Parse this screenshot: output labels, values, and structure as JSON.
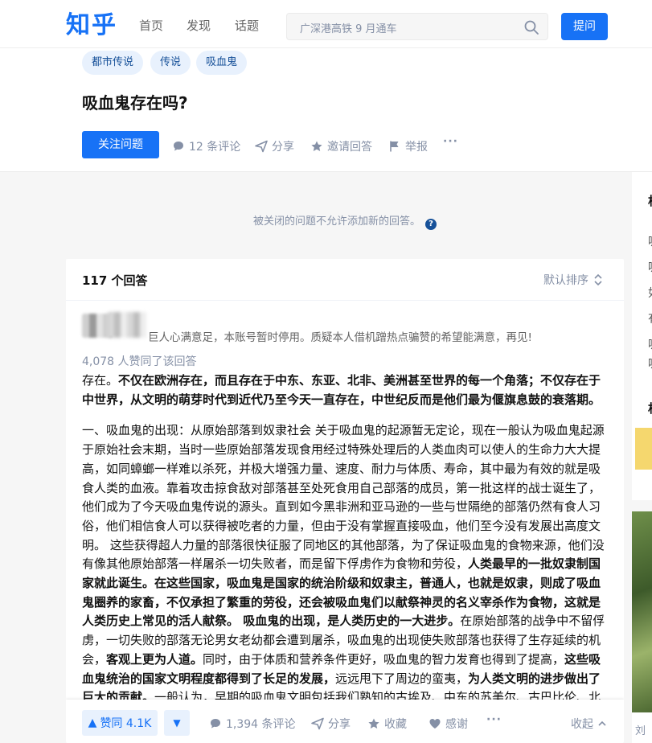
{
  "header": {
    "logo": "知乎",
    "nav": [
      "首页",
      "发现",
      "话题"
    ],
    "search_placeholder": "广深港高铁 9 月通车",
    "ask_label": "提问"
  },
  "question": {
    "tags": [
      "都市传说",
      "传说",
      "吸血鬼"
    ],
    "title": "吸血鬼存在吗?",
    "follow_label": "关注问题",
    "actions": {
      "comments": "12 条评论",
      "share": "分享",
      "invite": "邀请回答",
      "report": "举报",
      "more": "···"
    }
  },
  "closed_note": "被关闭的问题不允许添加新的回答。",
  "answers": {
    "count_label": "117 个回答",
    "sort_label": "默认排序",
    "author_bio": "巨人心满意足，本账号暂时停用。质疑本人借机蹭热点骗赞的希望能满意，再见!",
    "upvote_note": "4,078 人赞同了该回答",
    "para1": "存在。不仅在欧洲存在，而且存在于中东、东亚、北非、美洲甚至世界的每一个角落；不仅存在于中世界，从文明的萌芽时代到近代乃至今天一直存在，中世纪反而是他们最为偃旗息鼓的衰落期。",
    "para1_lead": "存在。",
    "para1_bold": "不仅在欧洲存在，而且存在于中东、东亚、北非、美洲甚至世界的每一个角落；不仅存在于中世界，从文明的萌芽时代到近代乃至今天一直存在，中世纪反而是他们最为偃旗息鼓的衰落期。",
    "p2_a": "一、吸血鬼的出现：从原始部落到奴隶社会 关于吸血鬼的起源暂无定论，现在一般认为吸血鬼起源于原始社会末期，当时一些原始部落发现食用经过特殊处理后的人类血肉可以使人的生命力大大提高，如同蟑螂一样难以杀死，并极大增强力量、速度、耐力与体质、寿命，其中最为有效的就是吸食人类的血液。靠着攻击掠食敌对部落甚至处死食用自己部落的成员，第一批这样的战士诞生了，他们成为了今天吸血鬼传说的源头。直到如今黑非洲和亚马逊的一些与世隔绝的部落仍然有食人习俗，他们相信食人可以获得被吃者的力量，但由于没有掌握直接吸血，他们至今没有发展出高度文明。 这些获得超人力量的部落很快征服了同地区的其他部落，为了保证吸血鬼的食物来源，他们没有像其他原始部落一样屠杀一切失败者，而是留下俘虏作为食物和劳役，",
    "p2_b": "人类最早的一批奴隶制国家就此诞生。在这些国家，吸血鬼是国家的统治阶级和奴隶主，普通人，也就是奴隶，则成了吸血鬼圈养的家畜，不仅承担了繁重的劳役，还会被吸血鬼们以献祭神灵的名义宰杀作为食物，这就是人类历史上常见的活人献祭。 吸血鬼的出现，是人类历史的一大进步。",
    "p2_c": "在原始部落的战争中不留俘虏，一切失败的部落无论男女老幼都会遭到屠杀，吸血鬼的出现使失败部落也获得了生存延续的机会，",
    "p2_d": "客观上更为人道。",
    "p2_e": "同时，由于体质和营养条件更好，吸血鬼的智力发育也得到了提高，",
    "p2_f": "这些吸血鬼统治的国家文明程度都得到了长足的发展，",
    "p2_g": "远远甩下了周边的蛮夷，",
    "p2_h": "为人类文明的进步做出了巨大的贡献。",
    "p2_i": "一般认为，早期的吸血鬼文明包括我们熟知的古埃及、中东的苏美尔、古巴比伦、北"
  },
  "footer": {
    "vote_label": "赞同 4.1K",
    "comments": "1,394 条评论",
    "share": "分享",
    "collect": "收藏",
    "thanks": "感谢",
    "more": "···",
    "collapse": "收起"
  },
  "sidebar": {
    "glyphs": [
      "相",
      "吸",
      "吸",
      "如",
      "有",
      "吸",
      "吸"
    ],
    "edge_glyph": "相",
    "bottom_text": "刘"
  },
  "colors": {
    "brand": "#1772f6",
    "tag_bg": "#e8f1fd",
    "tag_text": "#175199",
    "muted": "#8590a6"
  }
}
